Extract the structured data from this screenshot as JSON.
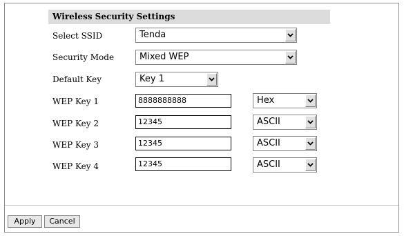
{
  "section": {
    "title": "Wireless Security Settings"
  },
  "ssid": {
    "label": "Select SSID",
    "value": "Tenda"
  },
  "security_mode": {
    "label": "Security Mode",
    "value": "Mixed WEP"
  },
  "default_key": {
    "label": "Default Key",
    "value": "Key 1"
  },
  "wep_keys": [
    {
      "label": "WEP Key 1",
      "value": "8888888888",
      "format": "Hex"
    },
    {
      "label": "WEP Key 2",
      "value": "12345",
      "format": "ASCII"
    },
    {
      "label": "WEP Key 3",
      "value": "12345",
      "format": "ASCII"
    },
    {
      "label": "WEP Key 4",
      "value": "12345",
      "format": "ASCII"
    }
  ],
  "buttons": {
    "apply": "Apply",
    "cancel": "Cancel"
  },
  "icons": {
    "dropdown": "chevron-down-icon"
  }
}
